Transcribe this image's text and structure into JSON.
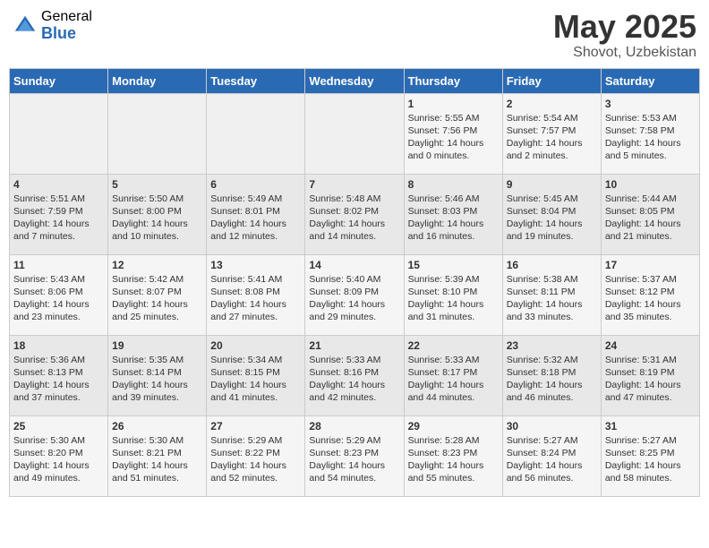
{
  "header": {
    "logo_general": "General",
    "logo_blue": "Blue",
    "title_month": "May 2025",
    "title_location": "Shovot, Uzbekistan"
  },
  "days_of_week": [
    "Sunday",
    "Monday",
    "Tuesday",
    "Wednesday",
    "Thursday",
    "Friday",
    "Saturday"
  ],
  "weeks": [
    [
      {
        "num": "",
        "info": ""
      },
      {
        "num": "",
        "info": ""
      },
      {
        "num": "",
        "info": ""
      },
      {
        "num": "",
        "info": ""
      },
      {
        "num": "1",
        "info": "Sunrise: 5:55 AM\nSunset: 7:56 PM\nDaylight: 14 hours and 0 minutes."
      },
      {
        "num": "2",
        "info": "Sunrise: 5:54 AM\nSunset: 7:57 PM\nDaylight: 14 hours and 2 minutes."
      },
      {
        "num": "3",
        "info": "Sunrise: 5:53 AM\nSunset: 7:58 PM\nDaylight: 14 hours and 5 minutes."
      }
    ],
    [
      {
        "num": "4",
        "info": "Sunrise: 5:51 AM\nSunset: 7:59 PM\nDaylight: 14 hours and 7 minutes."
      },
      {
        "num": "5",
        "info": "Sunrise: 5:50 AM\nSunset: 8:00 PM\nDaylight: 14 hours and 10 minutes."
      },
      {
        "num": "6",
        "info": "Sunrise: 5:49 AM\nSunset: 8:01 PM\nDaylight: 14 hours and 12 minutes."
      },
      {
        "num": "7",
        "info": "Sunrise: 5:48 AM\nSunset: 8:02 PM\nDaylight: 14 hours and 14 minutes."
      },
      {
        "num": "8",
        "info": "Sunrise: 5:46 AM\nSunset: 8:03 PM\nDaylight: 14 hours and 16 minutes."
      },
      {
        "num": "9",
        "info": "Sunrise: 5:45 AM\nSunset: 8:04 PM\nDaylight: 14 hours and 19 minutes."
      },
      {
        "num": "10",
        "info": "Sunrise: 5:44 AM\nSunset: 8:05 PM\nDaylight: 14 hours and 21 minutes."
      }
    ],
    [
      {
        "num": "11",
        "info": "Sunrise: 5:43 AM\nSunset: 8:06 PM\nDaylight: 14 hours and 23 minutes."
      },
      {
        "num": "12",
        "info": "Sunrise: 5:42 AM\nSunset: 8:07 PM\nDaylight: 14 hours and 25 minutes."
      },
      {
        "num": "13",
        "info": "Sunrise: 5:41 AM\nSunset: 8:08 PM\nDaylight: 14 hours and 27 minutes."
      },
      {
        "num": "14",
        "info": "Sunrise: 5:40 AM\nSunset: 8:09 PM\nDaylight: 14 hours and 29 minutes."
      },
      {
        "num": "15",
        "info": "Sunrise: 5:39 AM\nSunset: 8:10 PM\nDaylight: 14 hours and 31 minutes."
      },
      {
        "num": "16",
        "info": "Sunrise: 5:38 AM\nSunset: 8:11 PM\nDaylight: 14 hours and 33 minutes."
      },
      {
        "num": "17",
        "info": "Sunrise: 5:37 AM\nSunset: 8:12 PM\nDaylight: 14 hours and 35 minutes."
      }
    ],
    [
      {
        "num": "18",
        "info": "Sunrise: 5:36 AM\nSunset: 8:13 PM\nDaylight: 14 hours and 37 minutes."
      },
      {
        "num": "19",
        "info": "Sunrise: 5:35 AM\nSunset: 8:14 PM\nDaylight: 14 hours and 39 minutes."
      },
      {
        "num": "20",
        "info": "Sunrise: 5:34 AM\nSunset: 8:15 PM\nDaylight: 14 hours and 41 minutes."
      },
      {
        "num": "21",
        "info": "Sunrise: 5:33 AM\nSunset: 8:16 PM\nDaylight: 14 hours and 42 minutes."
      },
      {
        "num": "22",
        "info": "Sunrise: 5:33 AM\nSunset: 8:17 PM\nDaylight: 14 hours and 44 minutes."
      },
      {
        "num": "23",
        "info": "Sunrise: 5:32 AM\nSunset: 8:18 PM\nDaylight: 14 hours and 46 minutes."
      },
      {
        "num": "24",
        "info": "Sunrise: 5:31 AM\nSunset: 8:19 PM\nDaylight: 14 hours and 47 minutes."
      }
    ],
    [
      {
        "num": "25",
        "info": "Sunrise: 5:30 AM\nSunset: 8:20 PM\nDaylight: 14 hours and 49 minutes."
      },
      {
        "num": "26",
        "info": "Sunrise: 5:30 AM\nSunset: 8:21 PM\nDaylight: 14 hours and 51 minutes."
      },
      {
        "num": "27",
        "info": "Sunrise: 5:29 AM\nSunset: 8:22 PM\nDaylight: 14 hours and 52 minutes."
      },
      {
        "num": "28",
        "info": "Sunrise: 5:29 AM\nSunset: 8:23 PM\nDaylight: 14 hours and 54 minutes."
      },
      {
        "num": "29",
        "info": "Sunrise: 5:28 AM\nSunset: 8:23 PM\nDaylight: 14 hours and 55 minutes."
      },
      {
        "num": "30",
        "info": "Sunrise: 5:27 AM\nSunset: 8:24 PM\nDaylight: 14 hours and 56 minutes."
      },
      {
        "num": "31",
        "info": "Sunrise: 5:27 AM\nSunset: 8:25 PM\nDaylight: 14 hours and 58 minutes."
      }
    ]
  ]
}
